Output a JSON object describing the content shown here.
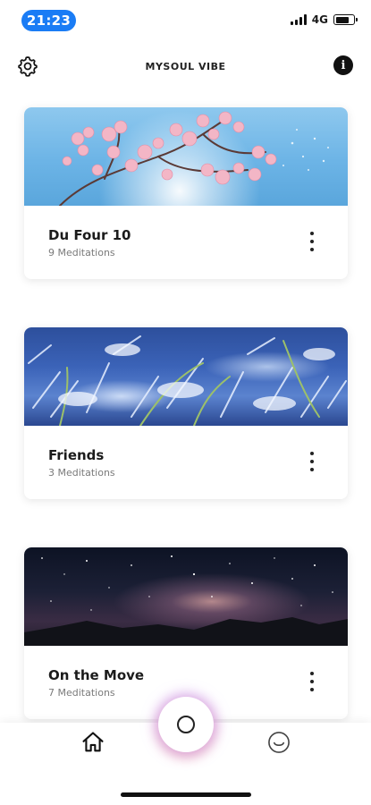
{
  "status_bar": {
    "time": "21:23",
    "network": "4G",
    "battery_level": 0.75,
    "icons": [
      "signal-icon",
      "battery-icon"
    ]
  },
  "header": {
    "title": "MYSOUL VIBE",
    "settings_icon": "gear-icon",
    "info_label": "i"
  },
  "playlists": [
    {
      "title": "Du Four 10",
      "subtitle": "9 Meditations",
      "image": "cherry-blossom-photo"
    },
    {
      "title": "Friends",
      "subtitle": "3 Meditations",
      "image": "frost-grass-photo"
    },
    {
      "title": "On the Move",
      "subtitle": "7 Meditations",
      "image": "milky-way-photo"
    }
  ],
  "bottom_nav": {
    "items": [
      "home-icon",
      "record-icon",
      "smiley-icon"
    ]
  },
  "colors": {
    "time_pill": "#1a7cf5",
    "text_primary": "#1b1b1b",
    "text_secondary": "#7a7a7a",
    "center_glow_purple": "#be82f0",
    "center_glow_orange": "#f58c78"
  }
}
